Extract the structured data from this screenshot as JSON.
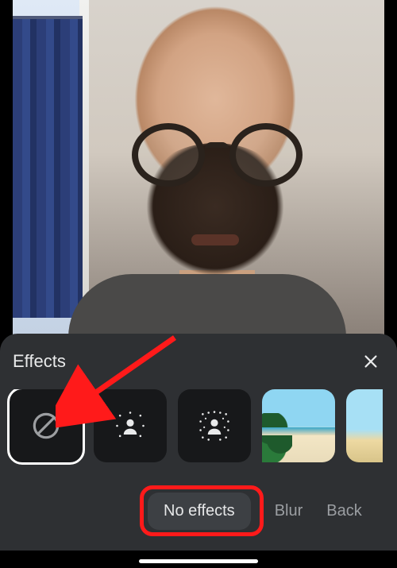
{
  "sheet": {
    "title": "Effects",
    "close_icon": "close-icon"
  },
  "effects": {
    "tiles": [
      {
        "id": "none",
        "icon": "prohibit-icon",
        "selected": true
      },
      {
        "id": "blur-light",
        "icon": "person-dots-sparse",
        "selected": false
      },
      {
        "id": "blur-strong",
        "icon": "person-dots-dense",
        "selected": false
      },
      {
        "id": "bg-beach-1",
        "icon": "image-thumbnail",
        "selected": false
      },
      {
        "id": "bg-beach-2",
        "icon": "image-thumbnail",
        "selected": false
      }
    ],
    "labels": [
      {
        "text": "No effects",
        "selected": true
      },
      {
        "text": "Blur",
        "selected": false
      },
      {
        "text": "Back",
        "selected": false
      }
    ]
  },
  "annotations": {
    "arrow_target": "effect-tile-none",
    "box_target": "effect-label-no-effects"
  }
}
